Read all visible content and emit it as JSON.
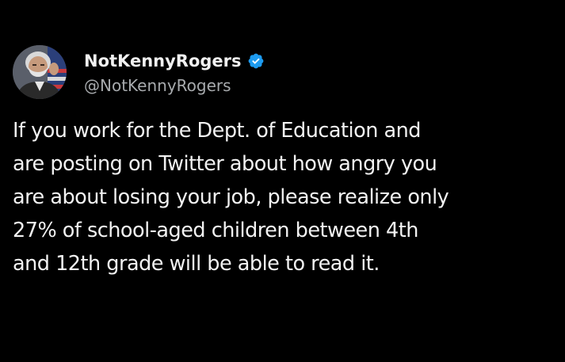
{
  "tweet": {
    "author": {
      "display_name": "NotKennyRogers",
      "handle": "@NotKennyRogers",
      "verified_icon": "verified-badge-icon",
      "avatar": "avatar-photo"
    },
    "text_lines": [
      "If you work for the Dept. of Education and",
      "are posting on Twitter about how angry you",
      "are about losing your job, please realize only",
      "27% of school-aged children between 4th",
      "and 12th grade will be able to read it."
    ]
  },
  "colors": {
    "background": "#000000",
    "name_text": "#f1f1f1",
    "handle_text": "#a7aaad",
    "body_text": "#f2f2f2",
    "verified_badge": "#1d9bf0"
  }
}
